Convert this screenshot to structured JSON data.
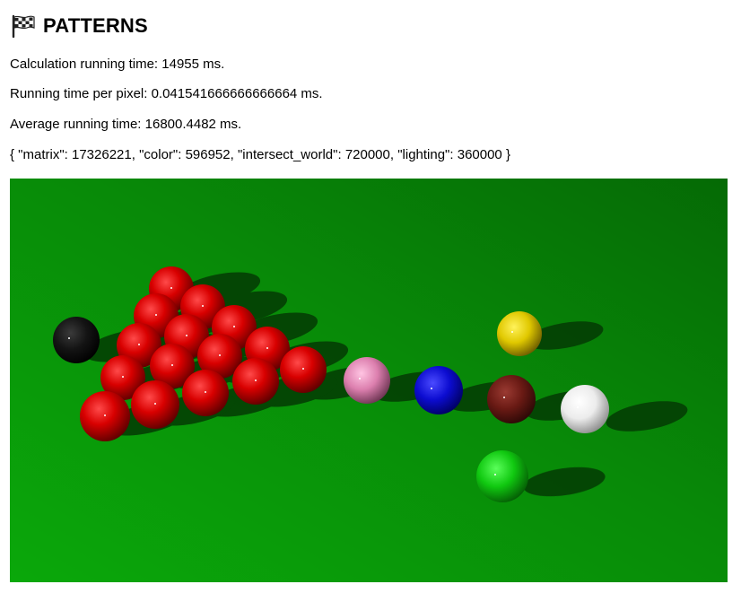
{
  "header": {
    "title": "PATTERNS",
    "icon": "checkered-flag-icon"
  },
  "stats": {
    "calc_time": "Calculation running time: 14955 ms.",
    "per_pixel": "Running time per pixel: 0.041541666666666664 ms.",
    "average": "Average running time: 16800.4482 ms.",
    "counts": "{ \"matrix\": 17326221, \"color\": 596952, \"intersect_world\": 720000, \"lighting\": 360000 }"
  },
  "render": {
    "table_color": "#0c8a0c",
    "ball_colors": {
      "red": "#d40000",
      "black": "#111111",
      "pink": "#dd7fb0",
      "blue": "#1010d0",
      "brown": "#6b1a14",
      "yellow": "#e5cf00",
      "white": "#f2f2f2",
      "green": "#11c811"
    }
  }
}
